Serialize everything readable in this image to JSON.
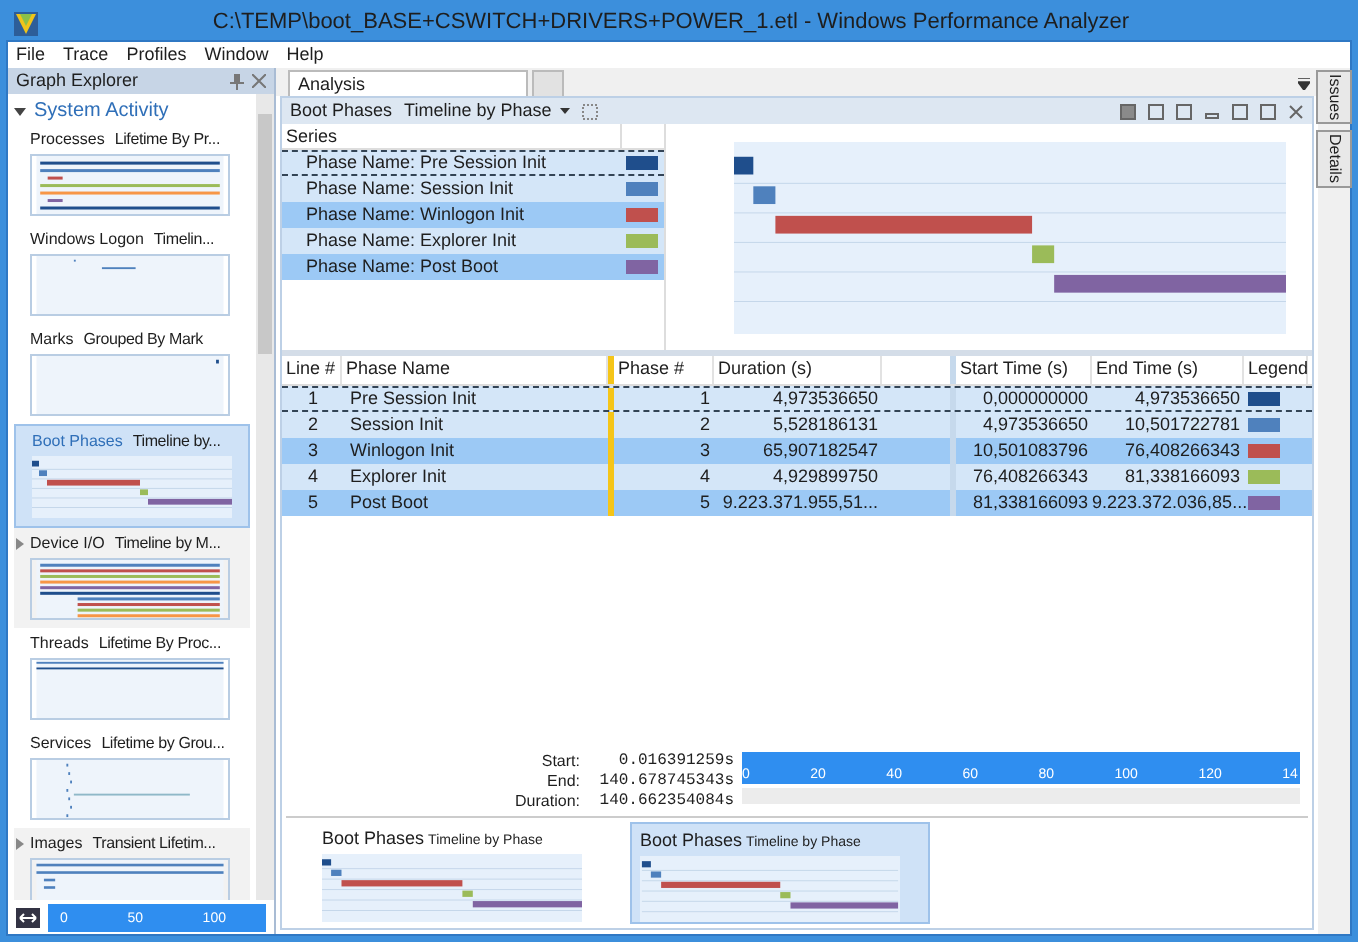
{
  "window": {
    "title": "C:\\TEMP\\boot_BASE+CSWITCH+DRIVERS+POWER_1.etl - Windows Performance Analyzer"
  },
  "menu": [
    "File",
    "Trace",
    "Profiles",
    "Window",
    "Help"
  ],
  "graph_explorer": {
    "title": "Graph Explorer",
    "group": "System Activity",
    "expanded": true,
    "items": [
      {
        "name": "Processes",
        "view": "Lifetime By Pr...",
        "selected": false,
        "expandable": false
      },
      {
        "name": "Windows Logon",
        "view": "Timelin...",
        "selected": false,
        "expandable": false
      },
      {
        "name": "Marks",
        "view": "Grouped By Mark",
        "selected": false,
        "expandable": false
      },
      {
        "name": "Boot Phases",
        "view": "Timeline by...",
        "selected": true,
        "expandable": false
      },
      {
        "name": "Device I/O",
        "view": "Timeline by M...",
        "selected": false,
        "expandable": true
      },
      {
        "name": "Threads",
        "view": "Lifetime By Proc...",
        "selected": false,
        "expandable": false
      },
      {
        "name": "Services",
        "view": "Lifetime by Grou...",
        "selected": false,
        "expandable": false
      },
      {
        "name": "Images",
        "view": "Transient Lifetim...",
        "selected": false,
        "expandable": true
      }
    ],
    "ruler": [
      "0",
      "50",
      "100"
    ]
  },
  "tabs": [
    {
      "label": "Analysis",
      "selected": true
    },
    {
      "selected": false
    }
  ],
  "side_tabs": [
    "Issues",
    "Details"
  ],
  "view": {
    "graph": "Boot Phases",
    "preset": "Timeline by Phase"
  },
  "series": {
    "header": "Series",
    "items": [
      {
        "label": "Phase Name: Pre Session Init",
        "color": "#1f4e8c",
        "selected": false
      },
      {
        "label": "Phase Name: Session Init",
        "color": "#4f81bd",
        "selected": false
      },
      {
        "label": "Phase Name: Winlogon Init",
        "color": "#c0504d",
        "selected": true
      },
      {
        "label": "Phase Name: Explorer Init",
        "color": "#9bbb59",
        "selected": false
      },
      {
        "label": "Phase Name: Post Boot",
        "color": "#8064a2",
        "selected": true
      }
    ]
  },
  "table": {
    "columns": [
      "Line #",
      "Phase Name",
      "Phase #",
      "Duration (s)",
      "Start Time (s)",
      "End Time (s)",
      "Legend"
    ],
    "rows": [
      {
        "line": "1",
        "name": "Pre Session Init",
        "phase": "1",
        "duration": "4,973536650",
        "start": "0,000000000",
        "end": "4,973536650",
        "color": "#1f4e8c",
        "selected": false
      },
      {
        "line": "2",
        "name": "Session Init",
        "phase": "2",
        "duration": "5,528186131",
        "start": "4,973536650",
        "end": "10,501722781",
        "color": "#4f81bd",
        "selected": false
      },
      {
        "line": "3",
        "name": "Winlogon Init",
        "phase": "3",
        "duration": "65,907182547",
        "start": "10,501083796",
        "end": "76,408266343",
        "color": "#c0504d",
        "selected": true
      },
      {
        "line": "4",
        "name": "Explorer Init",
        "phase": "4",
        "duration": "4,929899750",
        "start": "76,408266343",
        "end": "81,338166093",
        "color": "#9bbb59",
        "selected": false
      },
      {
        "line": "5",
        "name": "Post Boot",
        "phase": "5",
        "duration": "9.223.371.955,51...",
        "start": "81,338166093",
        "end": "9.223.372.036,85...",
        "color": "#8064a2",
        "selected": true
      }
    ]
  },
  "time_range": {
    "start_label": "Start:",
    "start": "0.016391259s",
    "end_label": "End:",
    "end": "140.678745343s",
    "duration_label": "Duration:",
    "duration": "140.662354084s",
    "ticks": [
      "0",
      "20",
      "40",
      "60",
      "80",
      "100",
      "120",
      "14"
    ]
  },
  "thumbnails": [
    {
      "graph": "Boot Phases",
      "preset": "Timeline by Phase",
      "selected": false
    },
    {
      "graph": "Boot Phases",
      "preset": "Timeline by Phase",
      "selected": true
    }
  ]
}
